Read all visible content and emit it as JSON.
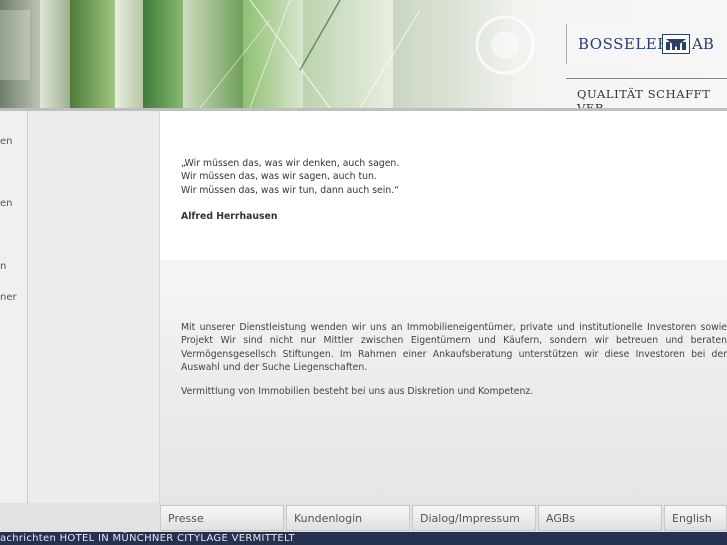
{
  "header": {
    "logo_text_left": "BOSSELER",
    "logo_text_right": "AB",
    "tagline": "QUALITÄT SCHAFFT VER"
  },
  "left_nav": {
    "items": [
      "en",
      "en",
      "n",
      "ner"
    ]
  },
  "content": {
    "quote_lines": [
      "„Wir müssen das, was wir denken, auch sagen.",
      "Wir müssen das, was wir sagen, auch tun.",
      "Wir müssen das, was wir tun, dann auch sein.“"
    ],
    "author": "Alfred Herrhausen",
    "paragraph": "Mit unserer Dienstleistung wenden wir uns an Immobilieneigentümer, private und institutionelle Investoren sowie Projekt Wir sind nicht nur Mittler zwischen Eigentümern und Käufern, sondern wir betreuen und beraten Vermögensgesellsch Stiftungen. Im Rahmen einer Ankaufsberatung unterstützen wir diese Investoren bei der Auswahl und der Suche Liegenschaften.",
    "paragraph2": "Vermittlung von Immobilien besteht bei uns aus Diskretion und Kompetenz."
  },
  "footer": {
    "buttons": [
      "Presse",
      "Kundenlogin",
      "Dialog/Impressum",
      "AGBs",
      "English"
    ]
  },
  "ticker": {
    "text": "achrichten  HOTEL IN MÜNCHNER CITYLAGE VERMITTELT"
  },
  "colors": {
    "brand_navy": "#2a3f6b",
    "ticker_bg": "#26304f"
  }
}
